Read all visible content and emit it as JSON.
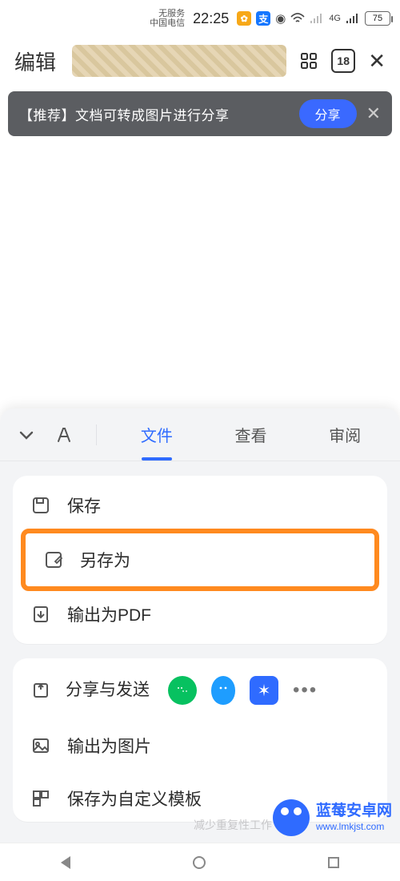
{
  "status": {
    "carrier1": "无服务",
    "carrier2": "中国电信",
    "time": "22:25",
    "signal_type": "4G",
    "battery": "75"
  },
  "appbar": {
    "edit_label": "编辑",
    "tab_count": "18"
  },
  "banner": {
    "text": "【推荐】文档可转成图片进行分享",
    "share_label": "分享"
  },
  "panel": {
    "tabs": {
      "file": "文件",
      "view": "查看",
      "review": "审阅"
    },
    "items": {
      "save": "保存",
      "save_as": "另存为",
      "export_pdf": "输出为PDF",
      "share_send": "分享与发送",
      "export_image": "输出为图片",
      "save_template": "保存为自定义模板"
    },
    "footer_hint": "减少重复性工作"
  },
  "watermark": {
    "name": "蓝莓安卓网",
    "url": "www.lmkjst.com"
  }
}
